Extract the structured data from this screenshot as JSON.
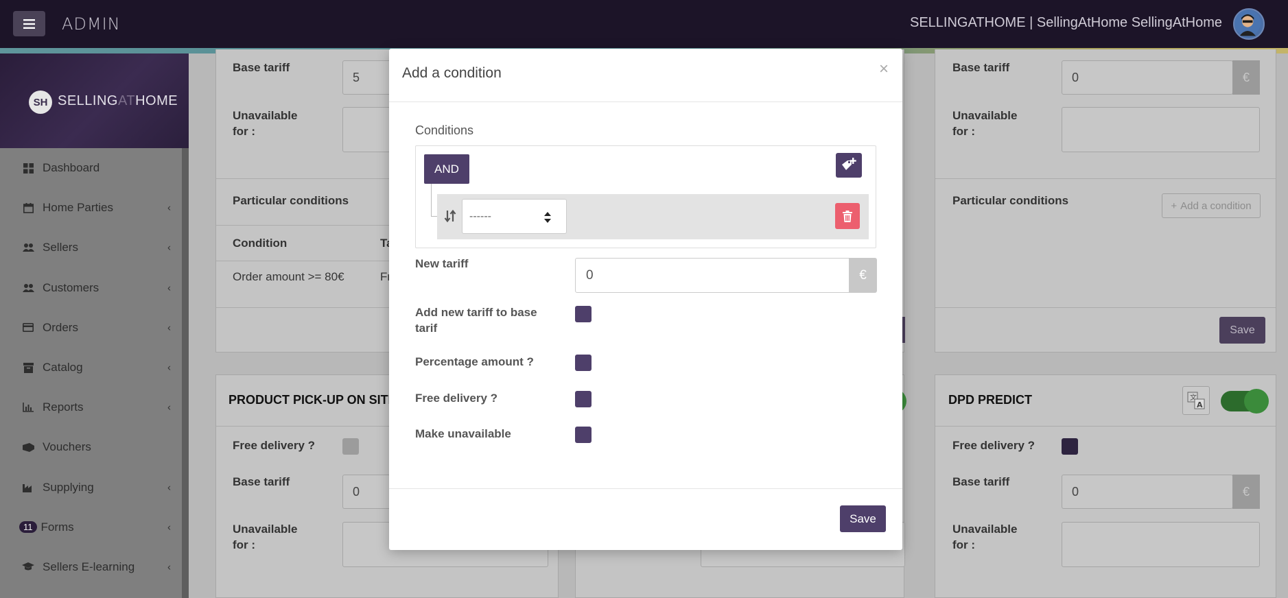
{
  "topbar": {
    "brand": "ADMIN",
    "user": "SELLINGATHOME | SellingAtHome SellingAtHome"
  },
  "sidebar": {
    "logo_initials": "SH",
    "logo_text_a": "SELLING",
    "logo_text_b": "AT",
    "logo_text_c": "HOME",
    "items": [
      {
        "label": "Dashboard",
        "icon": "dashboard-icon"
      },
      {
        "label": "Home Parties",
        "icon": "calendar-icon"
      },
      {
        "label": "Sellers",
        "icon": "users-icon"
      },
      {
        "label": "Customers",
        "icon": "users-icon"
      },
      {
        "label": "Orders",
        "icon": "credit-card-icon"
      },
      {
        "label": "Catalog",
        "icon": "archive-icon"
      },
      {
        "label": "Reports",
        "icon": "bar-chart-icon"
      },
      {
        "label": "Vouchers",
        "icon": "ticket-icon"
      },
      {
        "label": "Supplying",
        "icon": "industry-icon"
      },
      {
        "label": "Forms",
        "icon": "forms-icon",
        "badge": "11"
      },
      {
        "label": "Sellers E-learning",
        "icon": "graduation-cap-icon"
      }
    ]
  },
  "background": {
    "base_tariff_label": "Base tariff",
    "unavailable_label_1": "Unavailable",
    "unavailable_label_2": "for :",
    "particular_conditions": "Particular conditions",
    "condition_col": "Condition",
    "tariff_col_partial": "Ta",
    "condition_row": "Order amount >= 80€",
    "tariff_cell_partial": "Fr",
    "left_base_tariff_value": "5",
    "right_base_tariff_value": "0",
    "euro": "€",
    "add_condition": "Add a condition",
    "save": "Save",
    "pickup_title": "PRODUCT PICK-UP ON SITE",
    "dpd_title": "DPD PREDICT",
    "free_delivery_label": "Free delivery ?",
    "pickup_base_tariff_value": "0",
    "dpd_base_tariff_value": "0"
  },
  "modal": {
    "title": "Add a condition",
    "close": "×",
    "conditions_label": "Conditions",
    "and_label": "AND",
    "rule_select_value": "------",
    "new_tariff_label": "New tariff",
    "new_tariff_value": "0",
    "currency": "€",
    "add_to_base_label": "Add new tariff to base tarif",
    "percentage_label": "Percentage amount ?",
    "free_delivery_label": "Free delivery ?",
    "make_unavailable_label": "Make unavailable",
    "save_label": "Save"
  },
  "colors": {
    "accent": "#4e3f6a",
    "danger": "#ec5f6e",
    "topbar": "#1c1428"
  }
}
